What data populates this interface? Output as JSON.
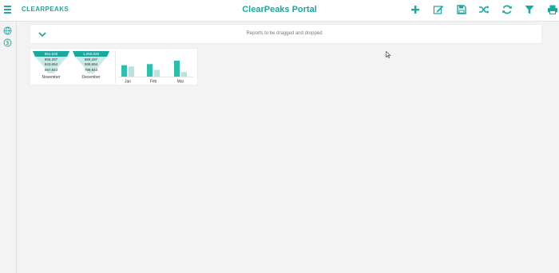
{
  "app": {
    "brand": "CLEARPEAKS",
    "title": "ClearPeaks Portal"
  },
  "toolbar": {
    "icons": [
      "plus-icon",
      "edit-icon",
      "save-icon",
      "shuffle-icon",
      "refresh-icon",
      "filter-icon",
      "print-icon"
    ]
  },
  "sidebar": {
    "icons": [
      "globe-icon",
      "dollar-icon"
    ]
  },
  "report_panel": {
    "drop_hint": "Reports to be dragged and dropped"
  },
  "funnels": [
    {
      "month": "November",
      "values": [
        "864,528",
        "856,287",
        "843,694",
        "567,843"
      ]
    },
    {
      "month": "December",
      "values": [
        "1,066,528",
        "869,287",
        "585,694",
        "789,843"
      ]
    }
  ],
  "chart_data": {
    "type": "bar",
    "categories": [
      "Jan",
      "Feb",
      "Mar"
    ],
    "series": [
      {
        "values": [
          10,
          11,
          14
        ]
      },
      {
        "values": [
          9,
          6,
          4
        ]
      }
    ],
    "title": "",
    "xlabel": "",
    "ylabel": "",
    "colors": [
      "#2bbfae",
      "#b6e5e0"
    ],
    "grid": false
  },
  "colors": {
    "accent": "#1aa89f",
    "funnel_top": "#1aa89f",
    "funnel_light": "#c9eae6"
  }
}
